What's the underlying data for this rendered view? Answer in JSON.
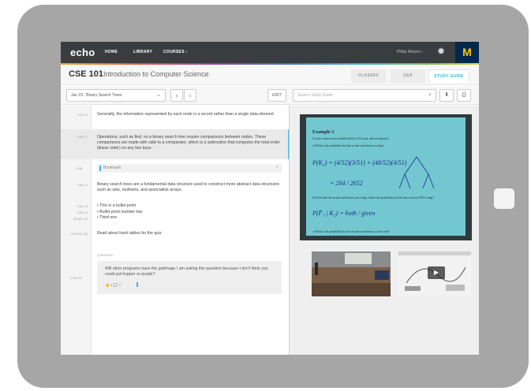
{
  "nav": {
    "logo": "echo",
    "links": [
      "HOME",
      "LIBRARY",
      "COURSES ›"
    ],
    "user": "Philip Meyers ›",
    "gear": "✹",
    "brand": "M"
  },
  "course": {
    "code": "CSE 101",
    "name": "Introduction to Computer Science",
    "tabs": [
      "CLASSES",
      "Q&A",
      "STUDY GUIDE"
    ],
    "active_tab": "STUDY GUIDE"
  },
  "toolbar": {
    "lecture_select": "Jan 23 : Binary Search Trees",
    "prev": "‹",
    "next": "›",
    "edit": "EDIT",
    "search_placeholder": "Search Study Guide"
  },
  "notes": [
    {
      "time": "4:15  |  3",
      "text": "Generally, the information represented by each node is a record rather than a single data element."
    },
    {
      "time": "5:18  |  7",
      "text": "Operations, such as find, on a binary search tree require comparisons between nodes. These comparisons are made with calls to a comparator, which is a subroutine that computes the total order (linear order) on any two keys.",
      "highlighted": true
    },
    {
      "time": "5:38",
      "bookmark": "Bookmark"
    },
    {
      "time": "7:46  |  4",
      "text": "Binary search trees are a fundamental data structure used to construct more abstract data structures such as sets, multisets, and associative arrays."
    },
    {
      "times": [
        "9:42  |  9",
        "5:00  |  3",
        "55:45  |  22"
      ],
      "bullets": [
        "• This is a bullet point",
        "• Bullet point number two",
        "• Third one"
      ]
    },
    {
      "time": "2:50:23  |  36",
      "text": "Read about hash tables for the quiz"
    }
  ],
  "questions": {
    "label": "Questions",
    "time": "2:50:23",
    "text": "Will other programs have the getImage I am asking this question because I don't think you could put hopper or purple?",
    "meta": "👍 5   💬 3"
  },
  "board": {
    "title": "Example 3",
    "lines": [
      "A card is drawn from a shuffled deck of 52 cards, and not replaced.",
      "a)  What is the probability that the second card drawn is a king?",
      "b)  Given that the second card drawn was a king, what is the probability that the first card was NOT a king?",
      "c)  What is the probability that the second card drawn is a face card?"
    ],
    "work1": "P(K₂) = (4/52)(3/51) + (48/52)(4/51)",
    "work2": "= 204 / 2652",
    "work3": "P(F̄₁ | K₂) = both / given"
  },
  "colors": {
    "accent": "#3cb3e6",
    "nav_bg": "#3a3d40",
    "um_blue": "#00274c",
    "um_maize": "#ffcb05"
  }
}
